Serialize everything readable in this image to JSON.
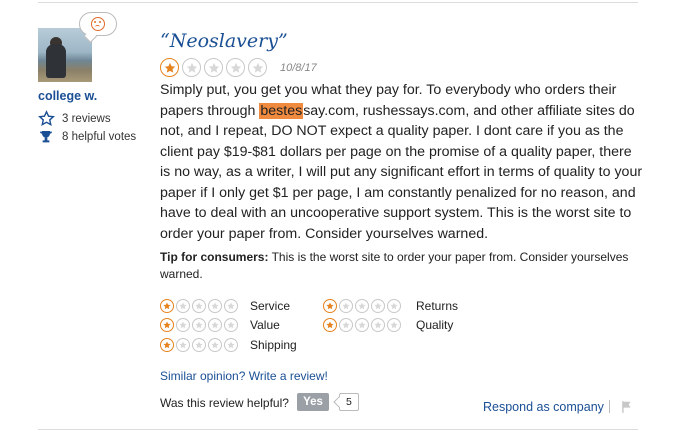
{
  "reviewer": {
    "name": "college w.",
    "reviews": "3 reviews",
    "helpful_votes": "8 helpful votes",
    "mood_icon": "sad-face-icon",
    "accent": "#e06a2a"
  },
  "review": {
    "title": "“Neoslavery”",
    "rating": 1,
    "rating_max": 5,
    "date": "10/8/17",
    "body_before": "Simply put, you get you what they pay for. To everybody who orders their papers through ",
    "body_highlight": "bestes",
    "body_after": "say.com, rushessays.com, and other affiliate sites do not, and I repeat, DO NOT expect a quality paper. I dont care if you as the client pay $19-$81 dollars per page on the promise of a quality paper, there is no way, as a writer, I will put any significant effort in terms of quality to your paper if I only get $1 per page, I am constantly penalized for no reason, and have to deal with an uncooperative support system. This is the worst site to order your paper from. Consider yourselves warned.",
    "tip_label": "Tip for consumers:",
    "tip_text": " This is the worst site to order your paper from. Consider yourselves warned."
  },
  "sub_ratings": [
    {
      "label": "Service",
      "rating": 1
    },
    {
      "label": "Value",
      "rating": 1
    },
    {
      "label": "Shipping",
      "rating": 1
    },
    {
      "label": "Returns",
      "rating": 1
    },
    {
      "label": "Quality",
      "rating": 1
    }
  ],
  "actions": {
    "similar_link": "Similar opinion? Write a review!",
    "helpful_question": "Was this review helpful?",
    "yes_label": "Yes",
    "yes_count": "5",
    "respond_link": "Respond as company",
    "flag_icon": "flag-icon"
  },
  "colors": {
    "link": "#1a4f94",
    "star": "#e6831f",
    "highlight": "#f08a3e"
  }
}
